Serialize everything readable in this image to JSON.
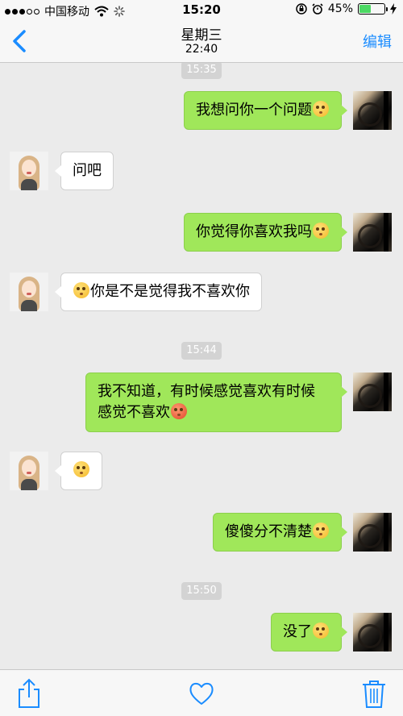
{
  "status_bar": {
    "carrier": "中国移动",
    "time": "15:20",
    "battery": "45%",
    "battery_level": 0.45
  },
  "nav": {
    "title": "星期三",
    "subtitle": "22:40",
    "edit_label": "编辑"
  },
  "conversation": {
    "ts1": "15:35",
    "m1": "我想问你一个问题",
    "m2": "问吧",
    "m3": "你觉得你喜欢我吗",
    "m4": "你是不是觉得我不喜欢你",
    "ts2": "15:44",
    "m5_line1": "我不知道，有时候感觉喜欢有时候",
    "m5_line2": "感觉不喜欢",
    "ts3": "15:50",
    "m7": "傻傻分不清楚",
    "m8": "没了"
  },
  "colors": {
    "accent": "#1a8cff",
    "bubble_me": "#a0e75a",
    "bubble_her": "#ffffff",
    "background": "#ebebeb"
  },
  "icons": [
    "back-chevron-icon",
    "wifi-icon",
    "loading-icon",
    "orientation-lock-icon",
    "alarm-icon",
    "battery-icon",
    "charging-icon",
    "share-icon",
    "heart-icon",
    "trash-icon"
  ]
}
